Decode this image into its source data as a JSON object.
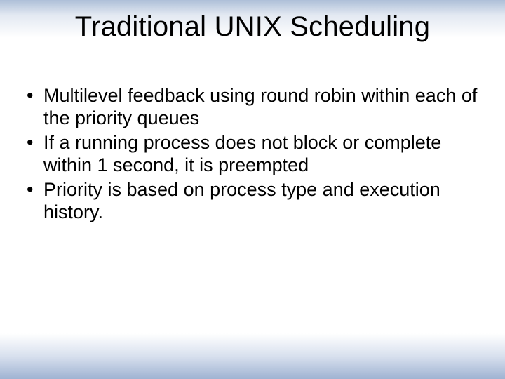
{
  "slide": {
    "title": "Traditional UNIX Scheduling",
    "bullets": [
      "Multilevel feedback using round robin within each of the priority queues",
      "If a running process does not block or complete within 1 second, it is preempted",
      "Priority is based on process type and execution history."
    ]
  }
}
